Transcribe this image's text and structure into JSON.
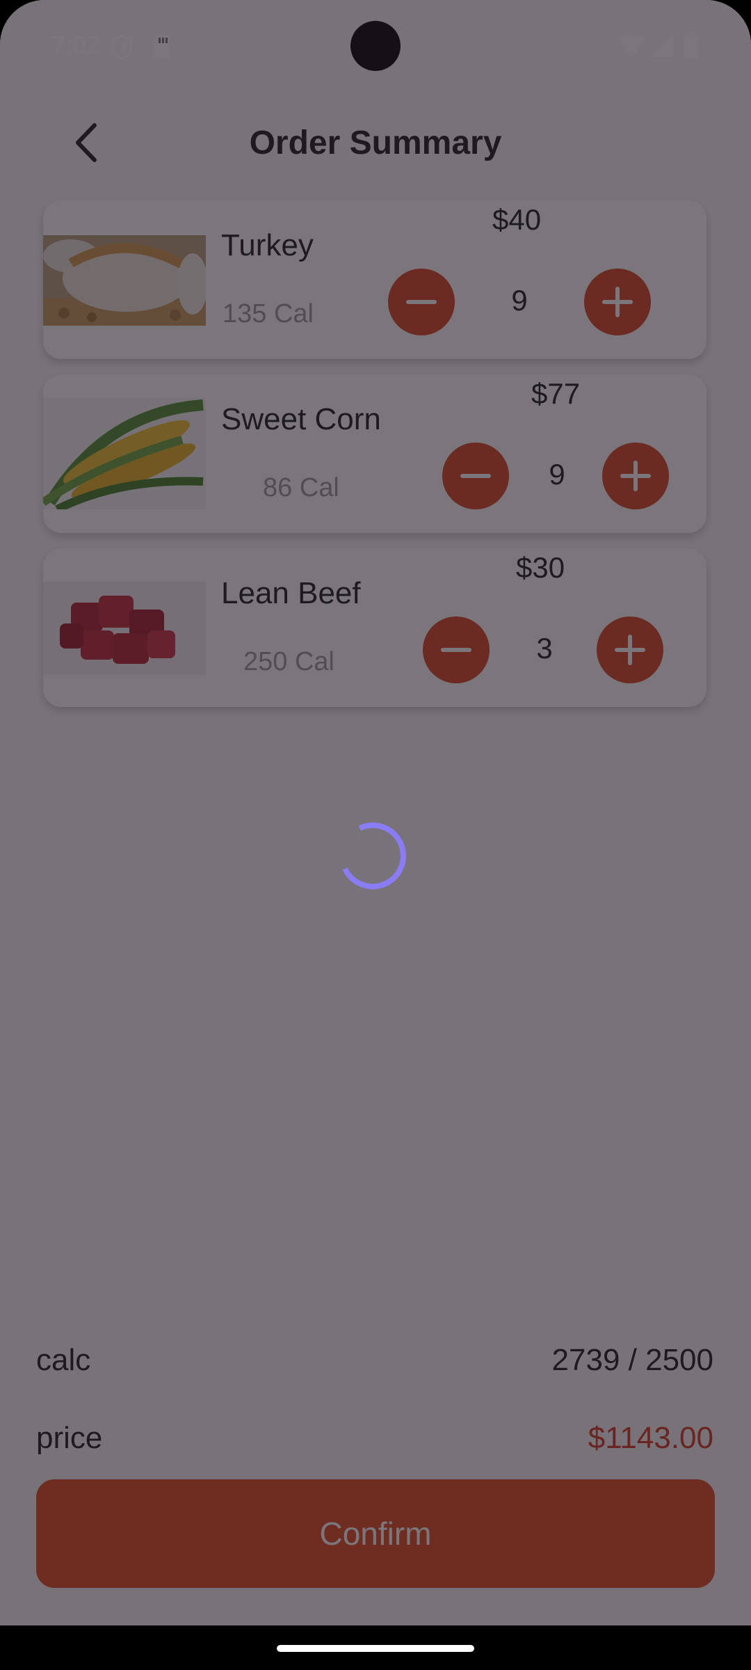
{
  "status_bar": {
    "time": "7:02",
    "icons": [
      "shield-icon",
      "sd-card-icon",
      "wifi-icon",
      "signal-icon",
      "battery-icon"
    ]
  },
  "header": {
    "title": "Order Summary",
    "back_icon": "chevron-left-icon"
  },
  "items": [
    {
      "name": "Turkey",
      "calories": "135 Cal",
      "price": "$40",
      "quantity": "9",
      "image": "turkey-image"
    },
    {
      "name": "Sweet Corn",
      "calories": "86 Cal",
      "price": "$77",
      "quantity": "9",
      "image": "corn-image"
    },
    {
      "name": "Lean Beef",
      "calories": "250 Cal",
      "price": "$30",
      "quantity": "3",
      "image": "beef-image"
    }
  ],
  "summary": {
    "calc_label": "calc",
    "calc_value": "2739 / 2500",
    "price_label": "price",
    "price_value": "$1143.00"
  },
  "confirm_label": "Confirm",
  "colors": {
    "accent": "#e34a1f",
    "price_red": "#d7331e",
    "spinner": "#8a7cf5"
  }
}
